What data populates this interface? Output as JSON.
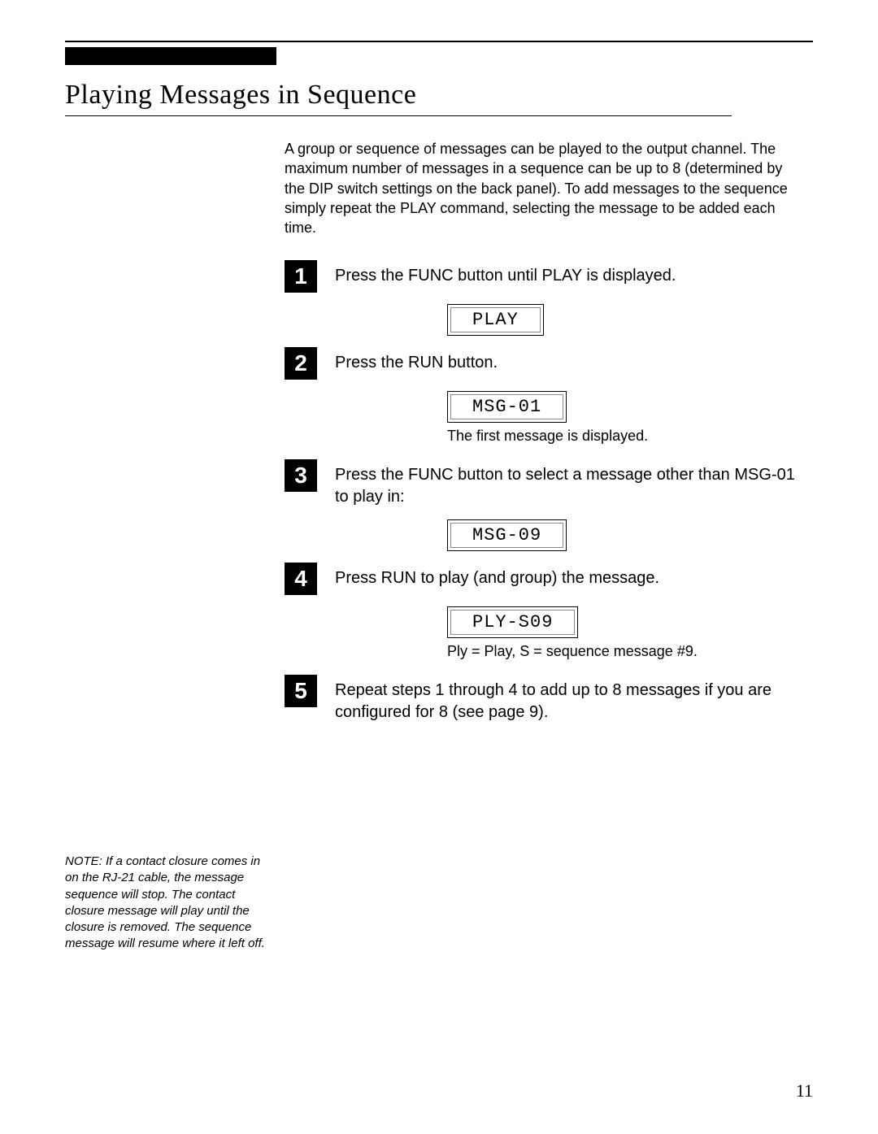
{
  "title": "Playing Messages in Sequence",
  "intro": "A group or sequence of messages can be played to the output channel. The maximum number of messages in a sequence can be up to 8 (determined by the DIP switch settings on the back panel). To add messages to the sequence simply repeat the PLAY command, selecting the message to be added each time.",
  "steps": {
    "s1": {
      "num": "1",
      "text": "Press the FUNC button until PLAY is displayed.",
      "lcd": "PLAY"
    },
    "s2": {
      "num": "2",
      "text": "Press the RUN button.",
      "lcd": "MSG-01",
      "caption": "The first message is displayed."
    },
    "s3": {
      "num": "3",
      "text": "Press the FUNC button to select a message other than MSG-01 to play in:",
      "lcd": "MSG-09"
    },
    "s4": {
      "num": "4",
      "text": "Press RUN to play (and group) the message.",
      "lcd": "PLY-S09",
      "caption": "Ply = Play, S = sequence message #9."
    },
    "s5": {
      "num": "5",
      "text": "Repeat steps 1 through 4 to add up to 8 messages if you are configured for 8 (see page 9)."
    }
  },
  "side_note": "NOTE: If a contact closure comes in on the RJ-21 cable, the message sequence will stop. The contact closure message will play until the closure is removed. The sequence message will resume where it left off.",
  "page_num": "11"
}
